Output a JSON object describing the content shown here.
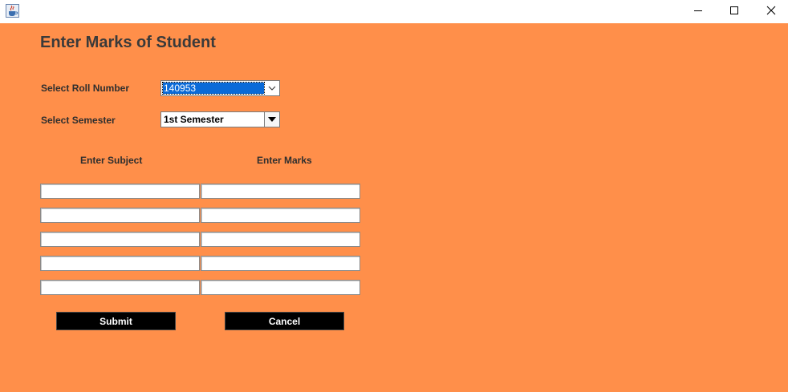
{
  "window": {
    "icon": "java-cup-icon",
    "controls": [
      "minimize-icon",
      "maximize-icon",
      "close-icon"
    ]
  },
  "form": {
    "title": "Enter Marks of Student",
    "roll_label": "Select Roll Number",
    "roll_value": "140953",
    "semester_label": "Select Semester",
    "semester_value": "1st Semester",
    "subject_header": "Enter Subject",
    "marks_header": "Enter Marks",
    "rows": [
      {
        "subject": "",
        "marks": ""
      },
      {
        "subject": "",
        "marks": ""
      },
      {
        "subject": "",
        "marks": ""
      },
      {
        "subject": "",
        "marks": ""
      },
      {
        "subject": "",
        "marks": ""
      }
    ],
    "submit_label": "Submit",
    "cancel_label": "Cancel"
  },
  "colors": {
    "background": "#ff8f4a",
    "selection": "#0a6ad8",
    "button": "#000000"
  }
}
